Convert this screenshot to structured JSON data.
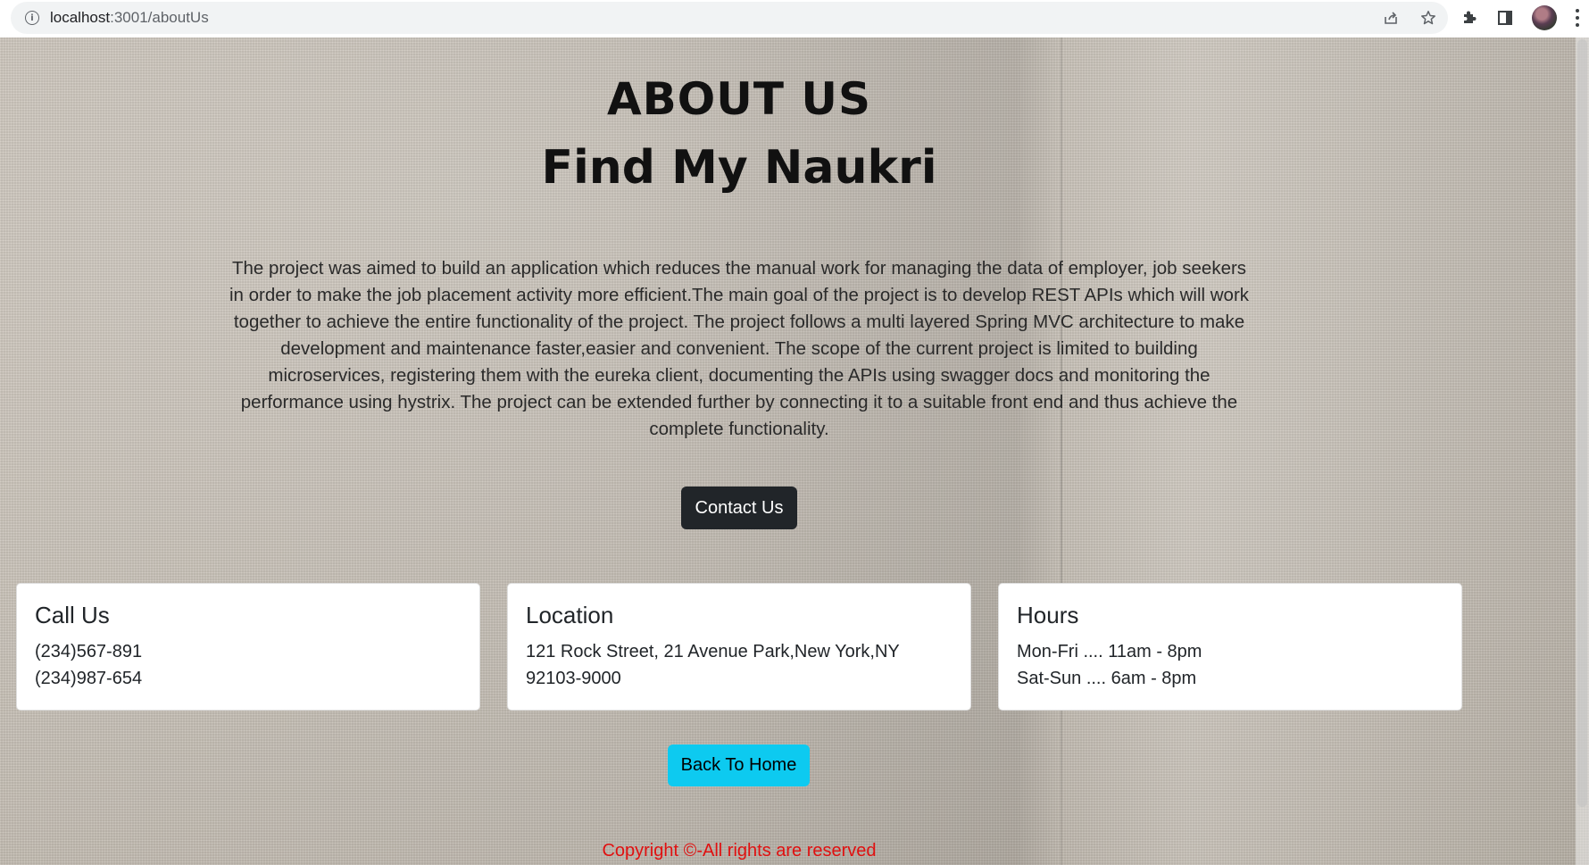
{
  "browser": {
    "url_host": "localhost",
    "url_path": ":3001/aboutUs"
  },
  "page": {
    "title": "ABOUT US",
    "subtitle": "Find My Naukri",
    "description": "The project was aimed to build an application which reduces the manual work for managing the data of employer, job seekers in order to make the job placement activity more efficient.The main goal of the project is to develop REST APIs which will work together to achieve the entire functionality of the project. The project follows a multi layered Spring MVC architecture to make development and maintenance faster,easier and convenient. The scope of the current project is limited to building microservices, registering them with the eureka client, documenting the APIs using swagger docs and monitoring the performance using hystrix. The project can be extended further by connecting it to a suitable front end and thus achieve the complete functionality.",
    "contact_button": "Contact Us",
    "cards": [
      {
        "title": "Call Us",
        "lines": [
          "(234)567-891",
          "(234)987-654"
        ]
      },
      {
        "title": "Location",
        "lines": [
          "121 Rock Street, 21 Avenue Park,New York,NY 92103-9000"
        ]
      },
      {
        "title": "Hours",
        "lines": [
          "Mon-Fri .... 11am - 8pm",
          "Sat-Sun .... 6am - 8pm"
        ]
      }
    ],
    "home_button": "Back To Home",
    "copyright": "Copyright ©-All rights are reserved"
  },
  "colors": {
    "contact_button_bg": "#212529",
    "home_button_bg": "#0dcaf0",
    "copyright_text": "#e01010"
  },
  "icons": [
    "info-icon",
    "share-icon",
    "star-icon",
    "extensions-icon",
    "side-panel-icon",
    "profile-avatar",
    "menu-icon"
  ]
}
